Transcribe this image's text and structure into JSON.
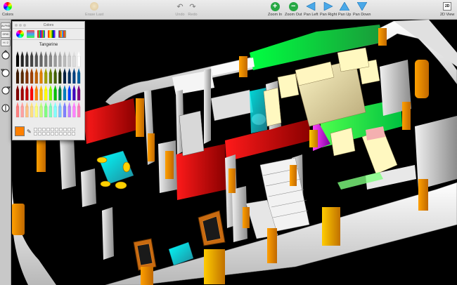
{
  "toolbar": {
    "colors_label": "Colors",
    "erase_last_label": "Erase Last",
    "undo_label": "Undo",
    "redo_label": "Redo",
    "zoom_in_label": "Zoom In",
    "zoom_out_label": "Zoom Out",
    "pan_left_label": "Pan Left",
    "pan_right_label": "Pan Right",
    "pan_up_label": "Pan Up",
    "pan_down_label": "Pan Down",
    "view_2d_icon_text": "2D",
    "view_2d_label": "2D View"
  },
  "tool_strip": {
    "items": [
      "ALPHA",
      "GRID",
      "H / 2"
    ]
  },
  "colors_panel": {
    "title": "Colors",
    "selected_color_name": "Tangerine",
    "selected_color_hex": "#ff8000"
  },
  "icons": [
    "colors-wheel-icon",
    "eraser-icon",
    "undo-icon",
    "redo-icon",
    "plus-icon",
    "minus-icon",
    "arrow-left-icon",
    "arrow-right-icon",
    "arrow-up-icon",
    "arrow-down-icon",
    "cube-2d-icon"
  ]
}
